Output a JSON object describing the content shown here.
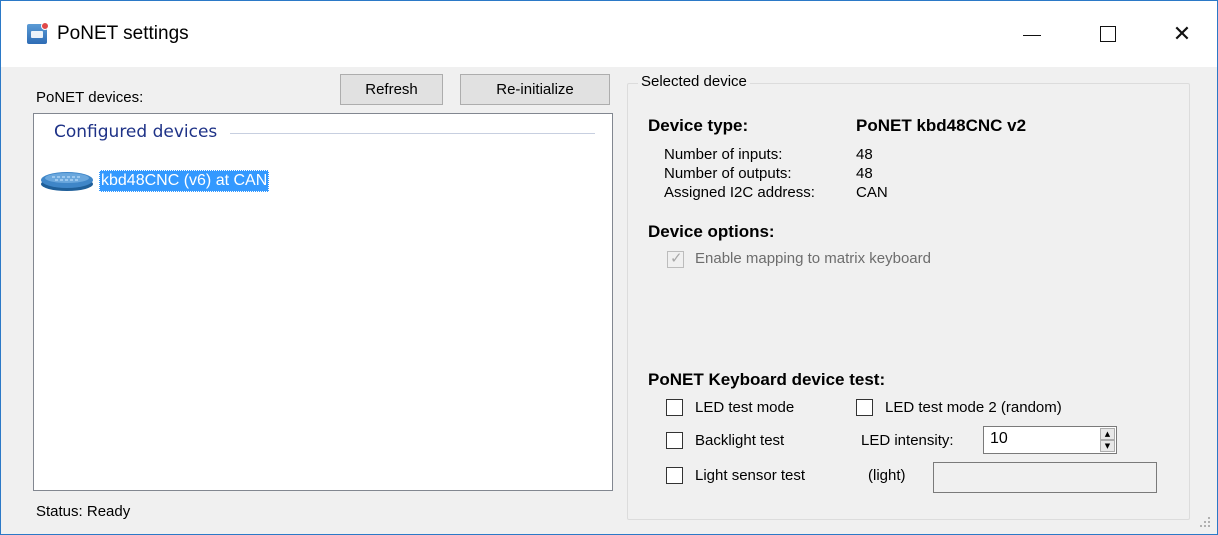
{
  "window": {
    "title": "PoNET settings",
    "icon": "ponet-app-icon",
    "controls": {
      "minimize": "minimize-icon",
      "maximize": "maximize-icon",
      "close": "close-icon",
      "close_glyph": "✕"
    }
  },
  "left_panel": {
    "devices_label": "PoNET devices:",
    "refresh_label": "Refresh",
    "reinit_label": "Re-initialize",
    "group_header": "Configured devices",
    "items": [
      {
        "label": "kbd48CNC (v6) at CAN",
        "icon": "keyboard-device-icon",
        "selected": true
      }
    ],
    "status": "Status: Ready"
  },
  "selected_device": {
    "group_title": "Selected device",
    "device_type_label": "Device type:",
    "device_type_value": "PoNET kbd48CNC v2",
    "inputs_label": "Number of inputs:",
    "inputs_value": "48",
    "outputs_label": "Number of outputs:",
    "outputs_value": "48",
    "address_label": "Assigned I2C address:",
    "address_value": "CAN",
    "options_heading": "Device options:",
    "enable_mapping_label": "Enable mapping to matrix keyboard",
    "enable_mapping_checked": true,
    "enable_mapping_disabled": true,
    "test_heading": "PoNET Keyboard device test:",
    "led_test_label": "LED test mode",
    "led_test2_label": "LED test mode 2 (random)",
    "backlight_label": "Backlight test",
    "led_intensity_label": "LED intensity:",
    "led_intensity_value": "10",
    "light_sensor_label": "Light sensor test",
    "light_label": "(light)",
    "light_value": ""
  },
  "colors": {
    "accent": "#3399ff",
    "group_header": "#1e3287",
    "window_border": "#2b79c7",
    "disabled_text": "#6d6d6d"
  }
}
